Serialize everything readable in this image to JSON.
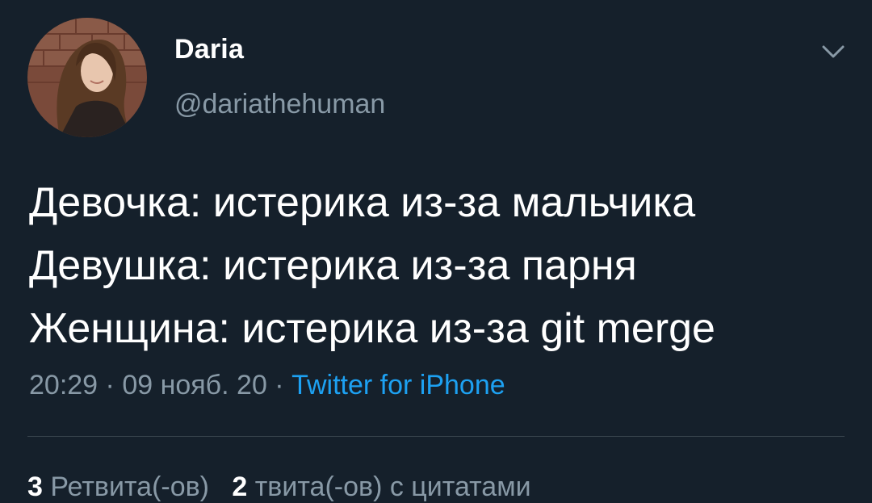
{
  "author": {
    "display_name": "Daria",
    "handle": "@dariathehuman",
    "avatar_icon": "profile-photo"
  },
  "tweet": {
    "lines": [
      "Девочка: истерика из-за мальчика",
      "Девушка: истерика из-за парня",
      "Женщина: истерика из-за git merge"
    ]
  },
  "meta": {
    "time": "20:29",
    "separator": " · ",
    "date": "09 нояб. 20",
    "source": "Twitter for iPhone"
  },
  "stats": {
    "retweets_count": "3",
    "retweets_label": "Ретвита(-ов)",
    "quotes_count": "2",
    "quotes_label": "твита(-ов) с цитатами"
  },
  "colors": {
    "background": "#15202b",
    "text": "#ffffff",
    "muted": "#8899a6",
    "link": "#1da1f2",
    "divider": "#38444d"
  }
}
